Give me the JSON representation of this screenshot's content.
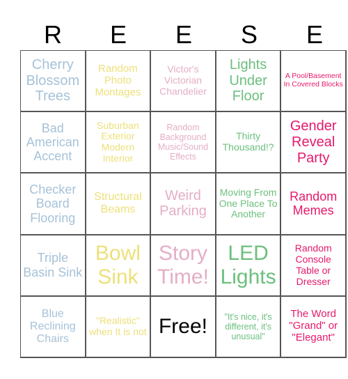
{
  "title_letters": [
    "R",
    "E",
    "E",
    "S",
    "E"
  ],
  "colors": {
    "blue": "#a6c2d8",
    "yellow": "#ede07a",
    "pink": "#e4aec6",
    "green": "#6cbf7e",
    "magenta": "#e5196b",
    "free": "#000000"
  },
  "board": [
    [
      "Cherry Blossom Trees",
      "Random Photo Montages",
      "Victor's Victorian Chandelier",
      "Lights Under Floor",
      "A Pool/Basement In Covered Blocks"
    ],
    [
      "Bad American Accent",
      "Suburban Exterior Modern Interior",
      "Random Background Music/Sound Effects",
      "Thirty Thousand!?",
      "Gender Reveal Party"
    ],
    [
      "Checker Board Flooring",
      "Structural Beams",
      "Weird Parking",
      "Moving From One Place To Another",
      "Random Memes"
    ],
    [
      "Triple Basin Sink",
      "Bowl Sink",
      "Story Time!",
      "LED Lights",
      "Random Console Table or Dresser"
    ],
    [
      "Blue Reclining Chairs",
      "\"Realistic\" when It is not",
      "Free!",
      "\"It's nice, it's different, it's unusual\"",
      "The Word \"Grand\" or \"Elegant\""
    ]
  ]
}
